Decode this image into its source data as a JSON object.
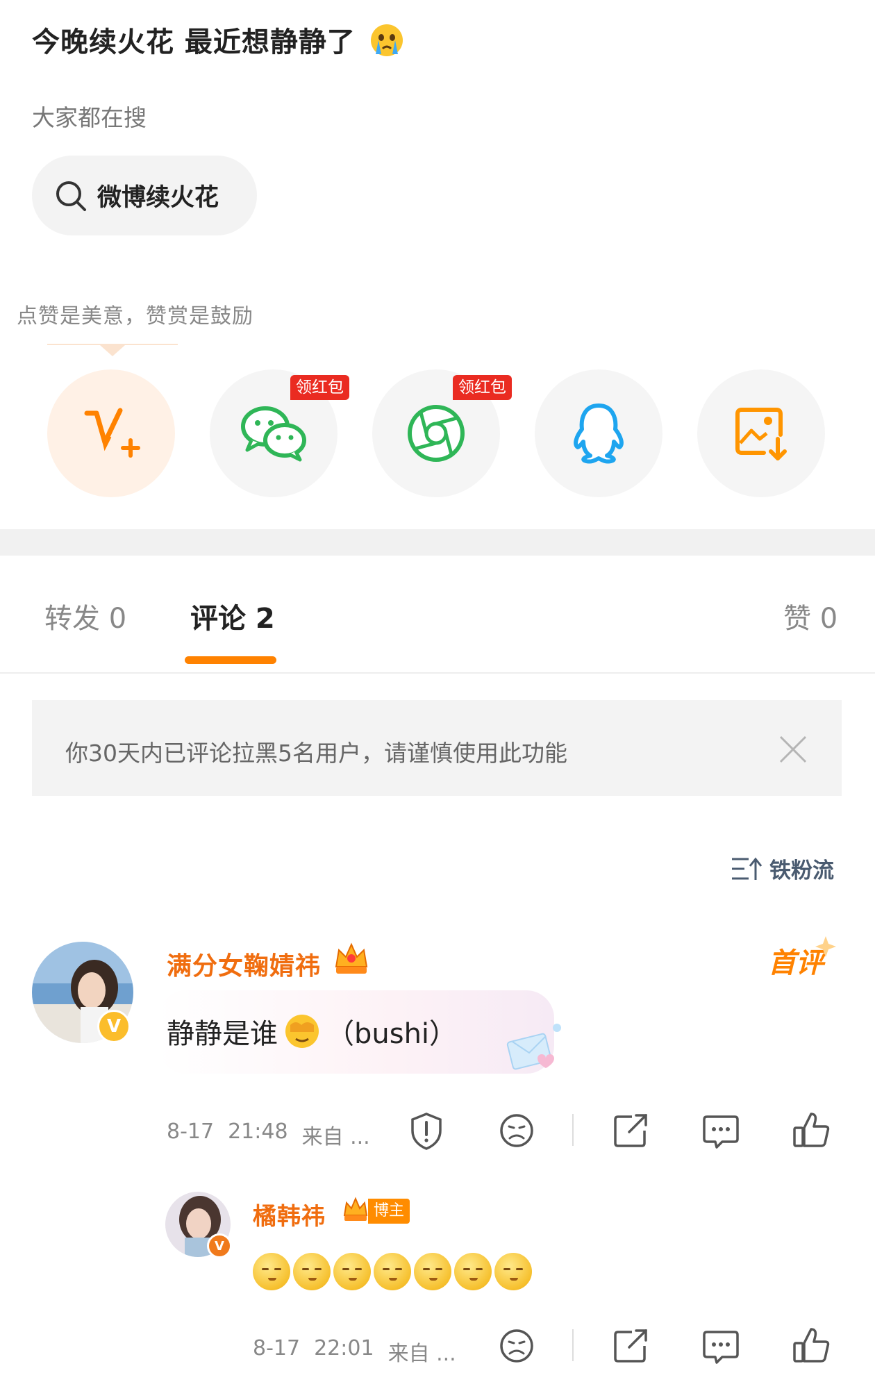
{
  "post": {
    "title": "今晚续火花  最近想静静了"
  },
  "trending": {
    "section_label": "大家都在搜",
    "chip_text": "微博续火花"
  },
  "share": {
    "tooltip": "点赞是美意，赞赏是鼓励",
    "hongbao_badge": "领红包",
    "items": [
      {
        "icon": "weibo-vplus-icon"
      },
      {
        "icon": "wechat-icon",
        "badge": true
      },
      {
        "icon": "moments-icon",
        "badge": true
      },
      {
        "icon": "qq-icon"
      },
      {
        "icon": "save-image-icon"
      }
    ]
  },
  "tabs": {
    "repost": "转发 0",
    "comment": "评论 2",
    "like": "赞 0"
  },
  "notice": {
    "text": "你30天内已评论拉黑5名用户，请谨慎使用此功能"
  },
  "sort": {
    "label": "铁粉流"
  },
  "comments": [
    {
      "username": "满分女鞠婧祎",
      "text_main": "静静是谁",
      "text_tail": "（bushi）",
      "badge": "首评",
      "date": "8-17",
      "time": "21:48",
      "source": "来自 ..."
    }
  ],
  "reply": {
    "username": "橘韩祎",
    "role_badge": "博主",
    "emoji_count": 7,
    "date": "8-17",
    "time": "22:01",
    "source": "来自 ..."
  },
  "colors": {
    "accent": "#ff8200",
    "username": "#f06d0f",
    "wechat": "#2fb657",
    "qq": "#1ea5ef",
    "badge_red": "#ea2b21",
    "verified": "#fbbd2b"
  }
}
